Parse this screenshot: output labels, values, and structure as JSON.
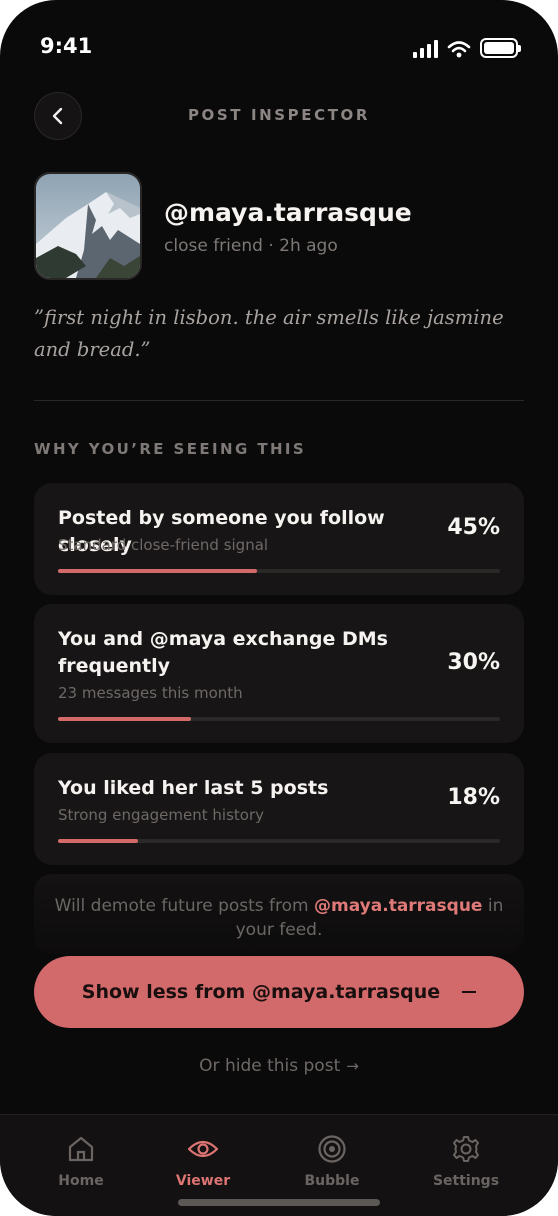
{
  "status_bar": {
    "time": "9:41"
  },
  "header": {
    "title": "POST INSPECTOR"
  },
  "profile": {
    "handle": "@maya.tarrasque",
    "meta": "close friend · 2h ago"
  },
  "post": {
    "quote": "”first night in lisbon. the air smells like jasmine and bread.”"
  },
  "section": {
    "label": "WHY YOU’RE SEEING THIS"
  },
  "reasons": [
    {
      "title": "Posted by someone you follow closely",
      "subtitle": "Standard close-friend signal",
      "percent_label": "45%",
      "weight": 0.45
    },
    {
      "title": "You and @maya exchange DMs frequently",
      "subtitle": "23 messages this month",
      "percent_label": "30%",
      "weight": 0.3
    },
    {
      "title": "You liked her last 5 posts",
      "subtitle": "Strong engagement history",
      "percent_label": "18%",
      "weight": 0.18
    }
  ],
  "note": {
    "before": "Will demote future posts from ",
    "handle": "@maya.tarrasque",
    "after": " in your feed."
  },
  "cta": {
    "label": "Show less from @maya.tarrasque",
    "icon": "minus-icon"
  },
  "secondary": {
    "label": "Or hide this post",
    "icon": "arrow-right-icon"
  },
  "tabs": [
    {
      "label": "Home",
      "icon": "home-icon",
      "active": false
    },
    {
      "label": "Viewer",
      "icon": "eye-icon",
      "active": true
    },
    {
      "label": "Bubble",
      "icon": "target-icon",
      "active": false
    },
    {
      "label": "Settings",
      "icon": "gear-icon",
      "active": false
    }
  ],
  "colors": {
    "accent": "#d2696a",
    "background": "#0b0a0a",
    "card": "#171515"
  }
}
